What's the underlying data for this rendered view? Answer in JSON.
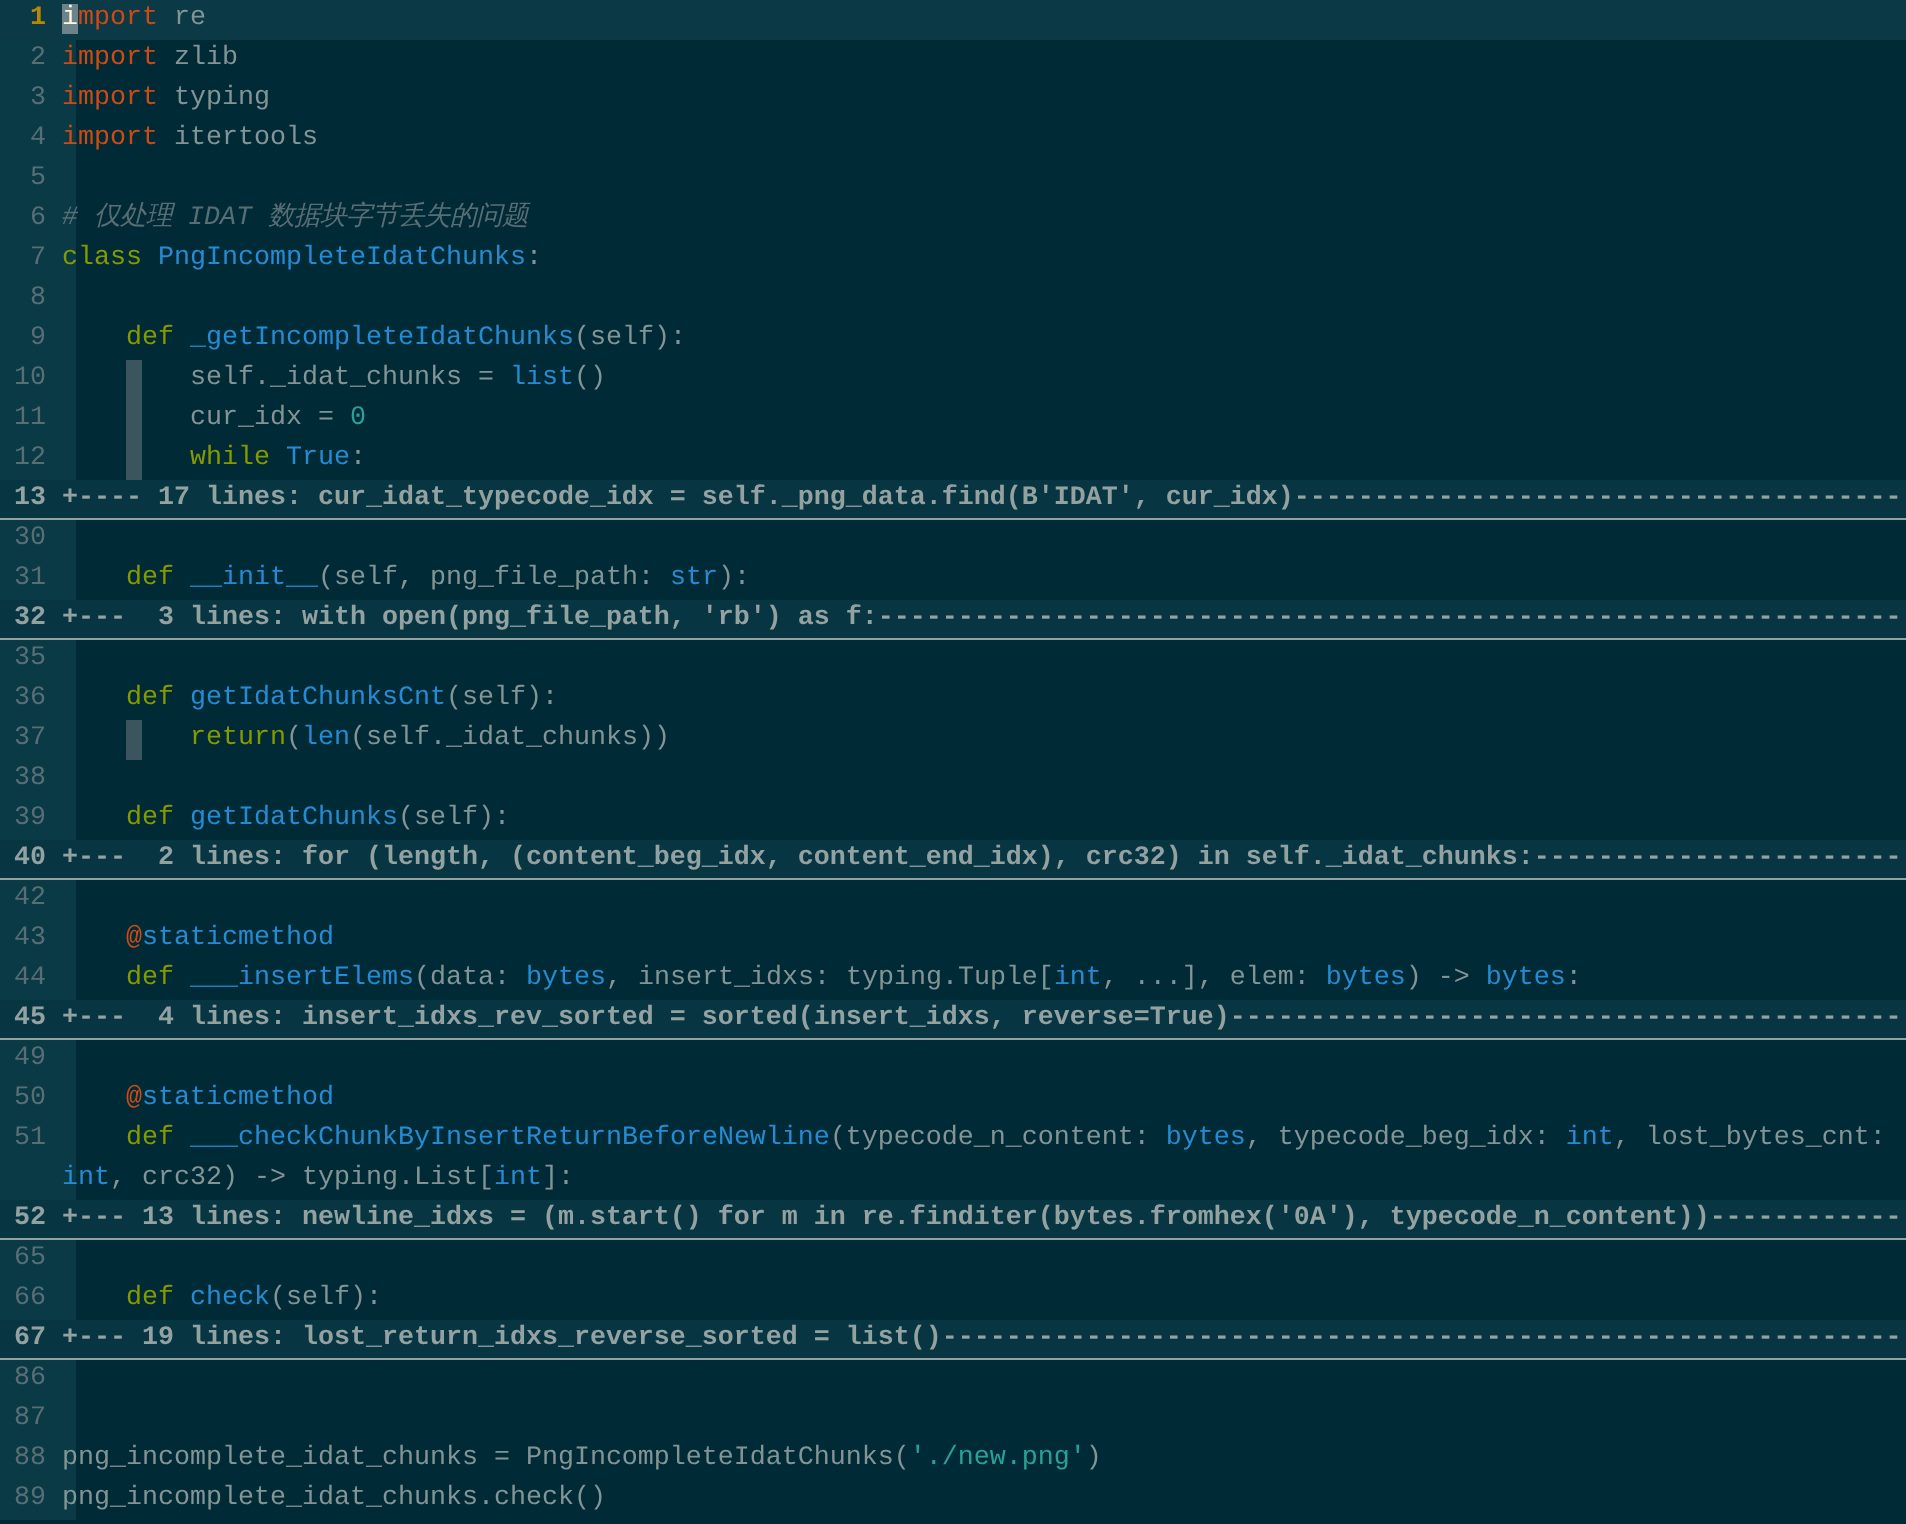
{
  "lines": [
    {
      "kind": "code",
      "number": "1",
      "current": true,
      "guide": false,
      "tokens": [
        {
          "kind": "cursor",
          "text": "i"
        },
        {
          "kind": "keyword",
          "text": "mport"
        },
        {
          "kind": "plain",
          "text": " re"
        }
      ]
    },
    {
      "kind": "code",
      "number": "2",
      "current": false,
      "guide": false,
      "tokens": [
        {
          "kind": "keyword",
          "text": "import"
        },
        {
          "kind": "plain",
          "text": " zlib"
        }
      ]
    },
    {
      "kind": "code",
      "number": "3",
      "current": false,
      "guide": false,
      "tokens": [
        {
          "kind": "keyword",
          "text": "import"
        },
        {
          "kind": "plain",
          "text": " typing"
        }
      ]
    },
    {
      "kind": "code",
      "number": "4",
      "current": false,
      "guide": false,
      "tokens": [
        {
          "kind": "keyword",
          "text": "import"
        },
        {
          "kind": "plain",
          "text": " itertools"
        }
      ]
    },
    {
      "kind": "code",
      "number": "5",
      "current": false,
      "guide": false
    },
    {
      "kind": "code",
      "number": "6",
      "current": false,
      "guide": false,
      "tokens": [
        {
          "kind": "comment",
          "text": "# 仅处理 IDAT 数据块字节丢失的问题"
        }
      ]
    },
    {
      "kind": "code",
      "number": "7",
      "current": false,
      "guide": false,
      "tokens": [
        {
          "kind": "statement",
          "text": "class "
        },
        {
          "kind": "name",
          "text": "PngIncompleteIdatChunks"
        },
        {
          "kind": "plain",
          "text": ":"
        }
      ]
    },
    {
      "kind": "code",
      "number": "8",
      "current": false,
      "guide": false
    },
    {
      "kind": "code",
      "number": "9",
      "current": false,
      "guide": false,
      "tokens": [
        {
          "kind": "statement",
          "text": "    def "
        },
        {
          "kind": "name",
          "text": "_getIncompleteIdatChunks"
        },
        {
          "kind": "plain",
          "text": "(self):"
        }
      ]
    },
    {
      "kind": "code",
      "number": "10",
      "current": false,
      "guide": true,
      "tokens": [
        {
          "kind": "plain",
          "text": "        self._idat_chunks = "
        },
        {
          "kind": "name",
          "text": "list"
        },
        {
          "kind": "plain",
          "text": "()"
        }
      ]
    },
    {
      "kind": "code",
      "number": "11",
      "current": false,
      "guide": true,
      "tokens": [
        {
          "kind": "plain",
          "text": "        cur_idx = "
        },
        {
          "kind": "number",
          "text": "0"
        }
      ]
    },
    {
      "kind": "code",
      "number": "12",
      "current": false,
      "guide": true,
      "tokens": [
        {
          "kind": "statement",
          "text": "        while "
        },
        {
          "kind": "name",
          "text": "True"
        },
        {
          "kind": "plain",
          "text": ":"
        }
      ]
    },
    {
      "kind": "fold",
      "number": "13",
      "text": "+---- 17 lines: cur_idat_typecode_idx = self._png_data.find(B'IDAT', cur_idx)--------------------------------------"
    },
    {
      "kind": "code",
      "number": "30",
      "current": false,
      "guide": false
    },
    {
      "kind": "code",
      "number": "31",
      "current": false,
      "guide": false,
      "tokens": [
        {
          "kind": "statement",
          "text": "    def "
        },
        {
          "kind": "name",
          "text": "__init__"
        },
        {
          "kind": "plain",
          "text": "(self, png_file_path: "
        },
        {
          "kind": "name",
          "text": "str"
        },
        {
          "kind": "plain",
          "text": "):"
        }
      ]
    },
    {
      "kind": "fold",
      "number": "32",
      "text": "+---  3 lines: with open(png_file_path, 'rb') as f:----------------------------------------------------------------"
    },
    {
      "kind": "code",
      "number": "35",
      "current": false,
      "guide": false
    },
    {
      "kind": "code",
      "number": "36",
      "current": false,
      "guide": false,
      "tokens": [
        {
          "kind": "statement",
          "text": "    def "
        },
        {
          "kind": "name",
          "text": "getIdatChunksCnt"
        },
        {
          "kind": "plain",
          "text": "(self):"
        }
      ]
    },
    {
      "kind": "code",
      "number": "37",
      "current": false,
      "guide": true,
      "tokens": [
        {
          "kind": "statement",
          "text": "        return"
        },
        {
          "kind": "plain",
          "text": "("
        },
        {
          "kind": "name",
          "text": "len"
        },
        {
          "kind": "plain",
          "text": "(self._idat_chunks))"
        }
      ]
    },
    {
      "kind": "code",
      "number": "38",
      "current": false,
      "guide": false
    },
    {
      "kind": "code",
      "number": "39",
      "current": false,
      "guide": false,
      "tokens": [
        {
          "kind": "statement",
          "text": "    def "
        },
        {
          "kind": "name",
          "text": "getIdatChunks"
        },
        {
          "kind": "plain",
          "text": "(self):"
        }
      ]
    },
    {
      "kind": "fold",
      "number": "40",
      "text": "+---  2 lines: for (length, (content_beg_idx, content_end_idx), crc32) in self._idat_chunks:-----------------------"
    },
    {
      "kind": "code",
      "number": "42",
      "current": false,
      "guide": false
    },
    {
      "kind": "code",
      "number": "43",
      "current": false,
      "guide": false,
      "tokens": [
        {
          "kind": "decorator",
          "text": "    @"
        },
        {
          "kind": "name",
          "text": "staticmethod"
        }
      ]
    },
    {
      "kind": "code",
      "number": "44",
      "current": false,
      "guide": false,
      "tokens": [
        {
          "kind": "statement",
          "text": "    def "
        },
        {
          "kind": "name",
          "text": "___insertElems"
        },
        {
          "kind": "plain",
          "text": "(data: "
        },
        {
          "kind": "name",
          "text": "bytes"
        },
        {
          "kind": "plain",
          "text": ", insert_idxs: typing.Tuple["
        },
        {
          "kind": "name",
          "text": "int"
        },
        {
          "kind": "plain",
          "text": ", ...], elem: "
        },
        {
          "kind": "name",
          "text": "bytes"
        },
        {
          "kind": "plain",
          "text": ") -> "
        },
        {
          "kind": "name",
          "text": "bytes"
        },
        {
          "kind": "plain",
          "text": ":"
        }
      ]
    },
    {
      "kind": "fold",
      "number": "45",
      "text": "+---  4 lines: insert_idxs_rev_sorted = sorted(insert_idxs, reverse=True)------------------------------------------"
    },
    {
      "kind": "code",
      "number": "49",
      "current": false,
      "guide": false
    },
    {
      "kind": "code",
      "number": "50",
      "current": false,
      "guide": false,
      "tokens": [
        {
          "kind": "decorator",
          "text": "    @"
        },
        {
          "kind": "name",
          "text": "staticmethod"
        }
      ]
    },
    {
      "kind": "code",
      "number": "51",
      "current": false,
      "guide": false,
      "tokens": [
        {
          "kind": "statement",
          "text": "    def "
        },
        {
          "kind": "name",
          "text": "___checkChunkByInsertReturnBeforeNewline"
        },
        {
          "kind": "plain",
          "text": "(typecode_n_content: "
        },
        {
          "kind": "name",
          "text": "bytes"
        },
        {
          "kind": "plain",
          "text": ", typecode_beg_idx: "
        },
        {
          "kind": "name",
          "text": "int"
        },
        {
          "kind": "plain",
          "text": ", lost_bytes_cnt:"
        }
      ]
    },
    {
      "kind": "continuation",
      "tokens": [
        {
          "kind": "name",
          "text": "int"
        },
        {
          "kind": "plain",
          "text": ", crc32) -> typing.List["
        },
        {
          "kind": "name",
          "text": "int"
        },
        {
          "kind": "plain",
          "text": "]:"
        }
      ]
    },
    {
      "kind": "fold",
      "number": "52",
      "text": "+--- 13 lines: newline_idxs = (m.start() for m in re.finditer(bytes.fromhex('0A'), typecode_n_content))------------"
    },
    {
      "kind": "code",
      "number": "65",
      "current": false,
      "guide": false
    },
    {
      "kind": "code",
      "number": "66",
      "current": false,
      "guide": false,
      "tokens": [
        {
          "kind": "statement",
          "text": "    def "
        },
        {
          "kind": "name",
          "text": "check"
        },
        {
          "kind": "plain",
          "text": "(self):"
        }
      ]
    },
    {
      "kind": "fold",
      "number": "67",
      "text": "+--- 19 lines: lost_return_idxs_reverse_sorted = list()------------------------------------------------------------"
    },
    {
      "kind": "code",
      "number": "86",
      "current": false,
      "guide": false
    },
    {
      "kind": "code",
      "number": "87",
      "current": false,
      "guide": false
    },
    {
      "kind": "code",
      "number": "88",
      "current": false,
      "guide": false,
      "tokens": [
        {
          "kind": "plain",
          "text": "png_incomplete_idat_chunks = PngIncompleteIdatChunks("
        },
        {
          "kind": "string",
          "text": "'./new.png'"
        },
        {
          "kind": "plain",
          "text": ")"
        }
      ]
    },
    {
      "kind": "code",
      "number": "89",
      "current": false,
      "guide": false,
      "tokens": [
        {
          "kind": "plain",
          "text": "png_incomplete_idat_chunks.check()"
        }
      ]
    }
  ]
}
